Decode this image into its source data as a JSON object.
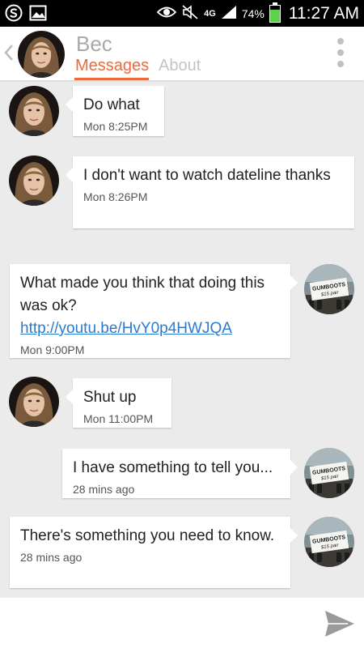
{
  "status_bar": {
    "network": "4G",
    "battery": "74%",
    "battery_level": 0.74,
    "time": "11:27 AM",
    "icons": [
      "app-s-icon",
      "gallery-icon",
      "eye-icon",
      "mute-icon",
      "signal-icon",
      "battery-icon"
    ]
  },
  "header": {
    "contact_name": "Bec",
    "tabs": [
      "Messages",
      "About"
    ],
    "active_tab": "Messages",
    "accent_color": "#ec6a3b"
  },
  "messages": [
    {
      "direction": "in",
      "text": "Do what",
      "time": "Mon 8:25PM"
    },
    {
      "direction": "in",
      "text": "I don't want to watch dateline thanks",
      "time": "Mon 8:26PM"
    },
    {
      "direction": "out",
      "text": "What made you think that doing this was ok?",
      "link": "http://youtu.be/HvY0p4HWJQA",
      "time": "Mon 9:00PM"
    },
    {
      "direction": "in",
      "text": "Shut up",
      "time": "Mon 11:00PM"
    },
    {
      "direction": "out",
      "text": "I have something to tell you...",
      "time": "28 mins ago"
    },
    {
      "direction": "out",
      "text": "There's something you need to know.",
      "time": "28 mins ago"
    }
  ],
  "avatar_sign_text": "GUMBOOTS $15 pair"
}
